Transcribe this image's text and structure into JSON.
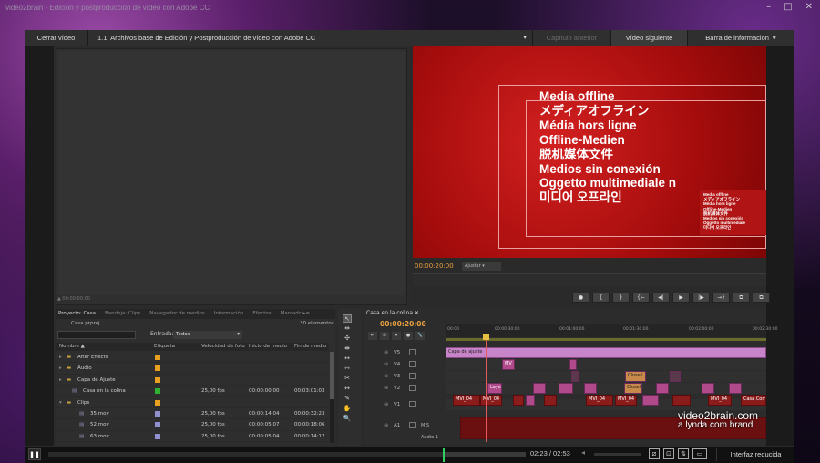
{
  "window": {
    "title": "video2brain - Edición y postproducción de vídeo con Adobe CC",
    "controls": [
      "–",
      "□",
      "✕"
    ]
  },
  "player_bar": {
    "close_label": "Cerrar vídeo",
    "chapter": "1.1.  Archivos base de Edición y Postproducción de vídeo con Adobe CC",
    "dim_tab": "Capítulo anterior",
    "next_label": "Vídeo siguiente",
    "info_label": "Barra de información"
  },
  "source_monitor": {
    "timecode": "▲ 00:00:00:00"
  },
  "program_monitor": {
    "titles": [
      "Media offline",
      "メディアオフライン",
      "Média hors ligne",
      "Offline-Medien",
      "脱机媒体文件",
      "Medios sin conexión",
      "Oggetto multimediale n",
      "미디어 오프라인"
    ],
    "thumb_lines": [
      "Media offline",
      "メディアオフライン",
      "Média hors ligne",
      "Offline-Medien",
      "脱机媒体文件",
      "Medios sin conexión",
      "Oggetto multimediale",
      "미디어 오프라인"
    ],
    "timecode": "00:00:20:00",
    "fit": "Ajustar",
    "controls": [
      "●",
      "{",
      "}",
      "{←",
      "◀|",
      "▶",
      "|▶",
      "→}",
      "⧉",
      "⧉"
    ]
  },
  "project_panel": {
    "tabs": [
      "Proyecto: Casa",
      "Bandeja: Clips",
      "Navegador de medios",
      "Información",
      "Efectos",
      "Marcadc ▸≡"
    ],
    "file": "Casa.prproj",
    "count": "30 elementos",
    "entrada_label": "Entrada:",
    "entrada_value": "Todos",
    "columns": [
      "Nombre ▲",
      "Etiqueta",
      "Velocidad de foto",
      "Inicio de medio",
      "Fin de medio"
    ],
    "rows": [
      {
        "name": "After Effects",
        "color": "#e8a020",
        "fps": "",
        "start": "",
        "end": "",
        "type": "folder"
      },
      {
        "name": "Audio",
        "color": "#e8a020",
        "fps": "",
        "start": "",
        "end": "",
        "type": "folder"
      },
      {
        "name": "Capa de Ajuste",
        "color": "#e8a020",
        "fps": "",
        "start": "",
        "end": "",
        "type": "folder"
      },
      {
        "name": "Casa en la colina",
        "color": "#30b030",
        "fps": "25,00 fps",
        "start": "00:00:00:00",
        "end": "00:03:01:03",
        "type": "seq"
      },
      {
        "name": "Clips",
        "color": "#e8a020",
        "fps": "",
        "start": "",
        "end": "",
        "type": "open"
      },
      {
        "name": "35.mov",
        "color": "#9090d0",
        "fps": "25,00 fps",
        "start": "00:00:14:04",
        "end": "00:00:32:23",
        "type": "clip"
      },
      {
        "name": "52.mov",
        "color": "#9090d0",
        "fps": "25,00 fps",
        "start": "00:00:05:07",
        "end": "00:00:18:06",
        "type": "clip"
      },
      {
        "name": "63.mov",
        "color": "#9090d0",
        "fps": "25,00 fps",
        "start": "00:00:05:04",
        "end": "00:00:14:12",
        "type": "clip"
      }
    ]
  },
  "tools": [
    "↖",
    "⇹",
    "✣",
    "⇼",
    "↔",
    "⇿",
    "✂",
    "↔",
    "✎",
    "✋",
    "🔍"
  ],
  "timeline": {
    "tab": "Casa en la colina ✕",
    "timecode": "00:00:20:00",
    "ticks": [
      "00:00",
      "00:00:30:00",
      "00:01:00:00",
      "00:01:30:00",
      "00:02:00:00",
      "00:02:30:00"
    ],
    "icons": [
      "⇤",
      "⊘",
      "▾",
      "●",
      "🔧"
    ],
    "tracks": [
      {
        "name": "V5",
        "t": ""
      },
      {
        "name": "V4",
        "t": ""
      },
      {
        "name": "V3",
        "t": ""
      },
      {
        "name": "V2",
        "t": ""
      },
      {
        "name": "V1",
        "t": ""
      },
      {
        "name": "A1",
        "t": "M  S"
      },
      {
        "name": "",
        "t": "Audio 1"
      }
    ],
    "clips": {
      "capa": "Capa de ajuste",
      "v4": "MV",
      "layer": "Layer",
      "clos": "Closeli",
      "mvi": "MVI_04",
      "casa": "Casa Com"
    }
  },
  "watermark": {
    "line1": "video2brain.com",
    "line2": "a lynda.com brand"
  },
  "bottom_bar": {
    "play_icon": "pause-icon",
    "time": "02:23 / 02:53",
    "progress": 0.826,
    "reduced_label": "Interfaz reducida"
  }
}
